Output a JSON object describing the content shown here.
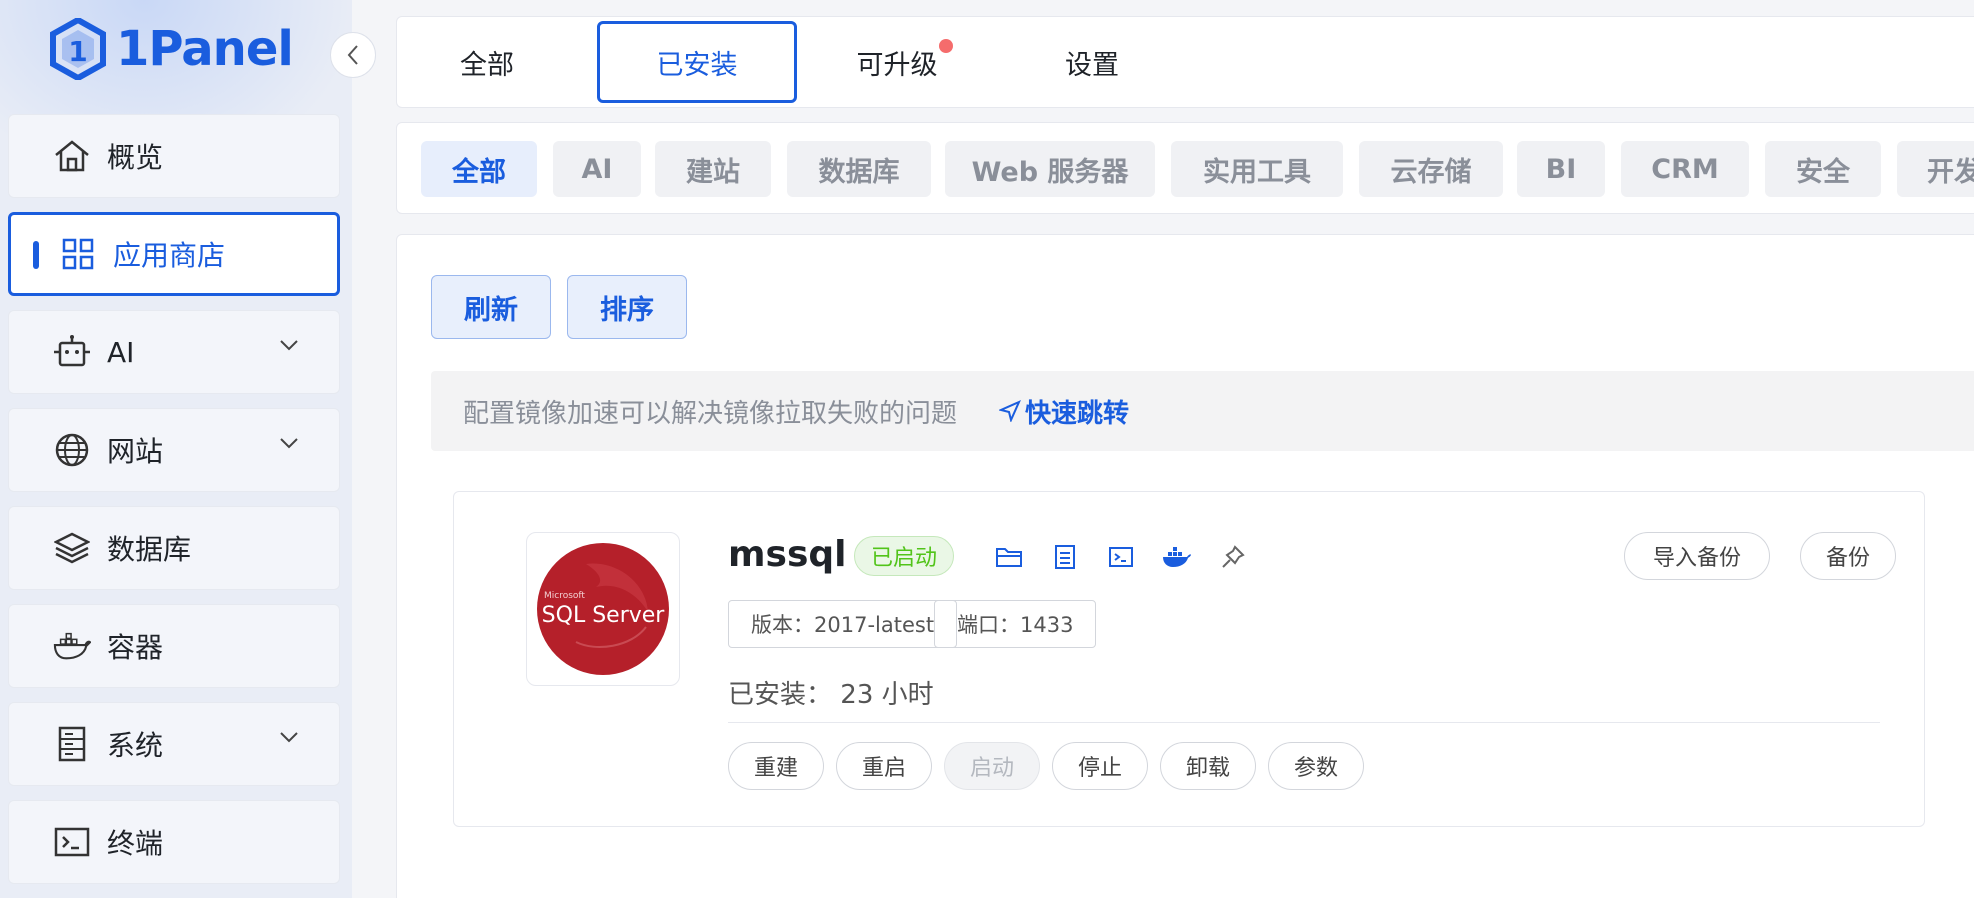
{
  "brand": {
    "name": "1Panel",
    "color": "#1a5dde"
  },
  "sidebar": {
    "items": [
      {
        "label": "概览",
        "icon": "home-icon"
      },
      {
        "label": "应用商店",
        "icon": "grid-icon",
        "active": true
      },
      {
        "label": "AI",
        "icon": "robot-icon",
        "expandable": true
      },
      {
        "label": "网站",
        "icon": "globe-icon",
        "expandable": true
      },
      {
        "label": "数据库",
        "icon": "layers-icon"
      },
      {
        "label": "容器",
        "icon": "docker-icon"
      },
      {
        "label": "系统",
        "icon": "server-icon",
        "expandable": true
      },
      {
        "label": "终端",
        "icon": "terminal-icon"
      }
    ]
  },
  "tabs": [
    {
      "label": "全部"
    },
    {
      "label": "已安装",
      "active": true
    },
    {
      "label": "可升级",
      "badge": true
    },
    {
      "label": "设置"
    }
  ],
  "categories": [
    "全部",
    "AI",
    "建站",
    "数据库",
    "Web 服务器",
    "实用工具",
    "云存储",
    "BI",
    "CRM",
    "安全",
    "开发"
  ],
  "toolbar": {
    "refresh": "刷新",
    "sort": "排序"
  },
  "notice": {
    "text": "配置镜像加速可以解决镜像拉取失败的问题",
    "link": "快速跳转"
  },
  "app": {
    "name": "mssql",
    "status": "已启动",
    "logo_text": "SQL Server",
    "logo_brand": "Microsoft",
    "version_label": "版本：2017-latest",
    "port_label": "端口：1433",
    "installed_label": "已安装：",
    "installed_value": "23 小时",
    "import_backup": "导入备份",
    "backup": "备份",
    "actions": [
      "重建",
      "重启",
      "启动",
      "停止",
      "卸载",
      "参数"
    ],
    "disabled_action": "启动"
  }
}
